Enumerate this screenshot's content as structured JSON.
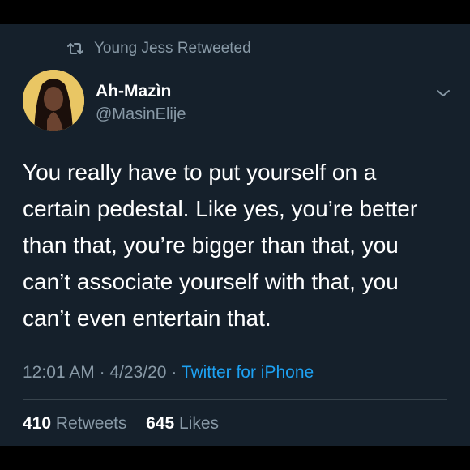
{
  "retweet": {
    "icon": "retweet-icon",
    "text": "Young Jess Retweeted"
  },
  "author": {
    "name": "Ah-Mazìn",
    "handle": "@MasinElije",
    "avatar": "profile-avatar-photo"
  },
  "menu": {
    "icon": "chevron-down-icon"
  },
  "tweet": {
    "lines": [
      "You really have to put yourself on a",
      "certain pedestal. Like yes, you’re better",
      "than that, you’re bigger than that, you",
      "can’t associate yourself with that, you",
      "can’t even entertain that."
    ]
  },
  "meta": {
    "time": "12:01 AM",
    "separator": " · ",
    "date": "4/23/20",
    "source": "Twitter for iPhone"
  },
  "stats": {
    "retweets_count": "410",
    "retweets_label": "Retweets",
    "likes_count": "645",
    "likes_label": "Likes"
  },
  "colors": {
    "background": "#15202b",
    "text": "#ffffff",
    "secondary": "#8899a6",
    "link": "#1da1f2",
    "divider": "#38444d"
  }
}
